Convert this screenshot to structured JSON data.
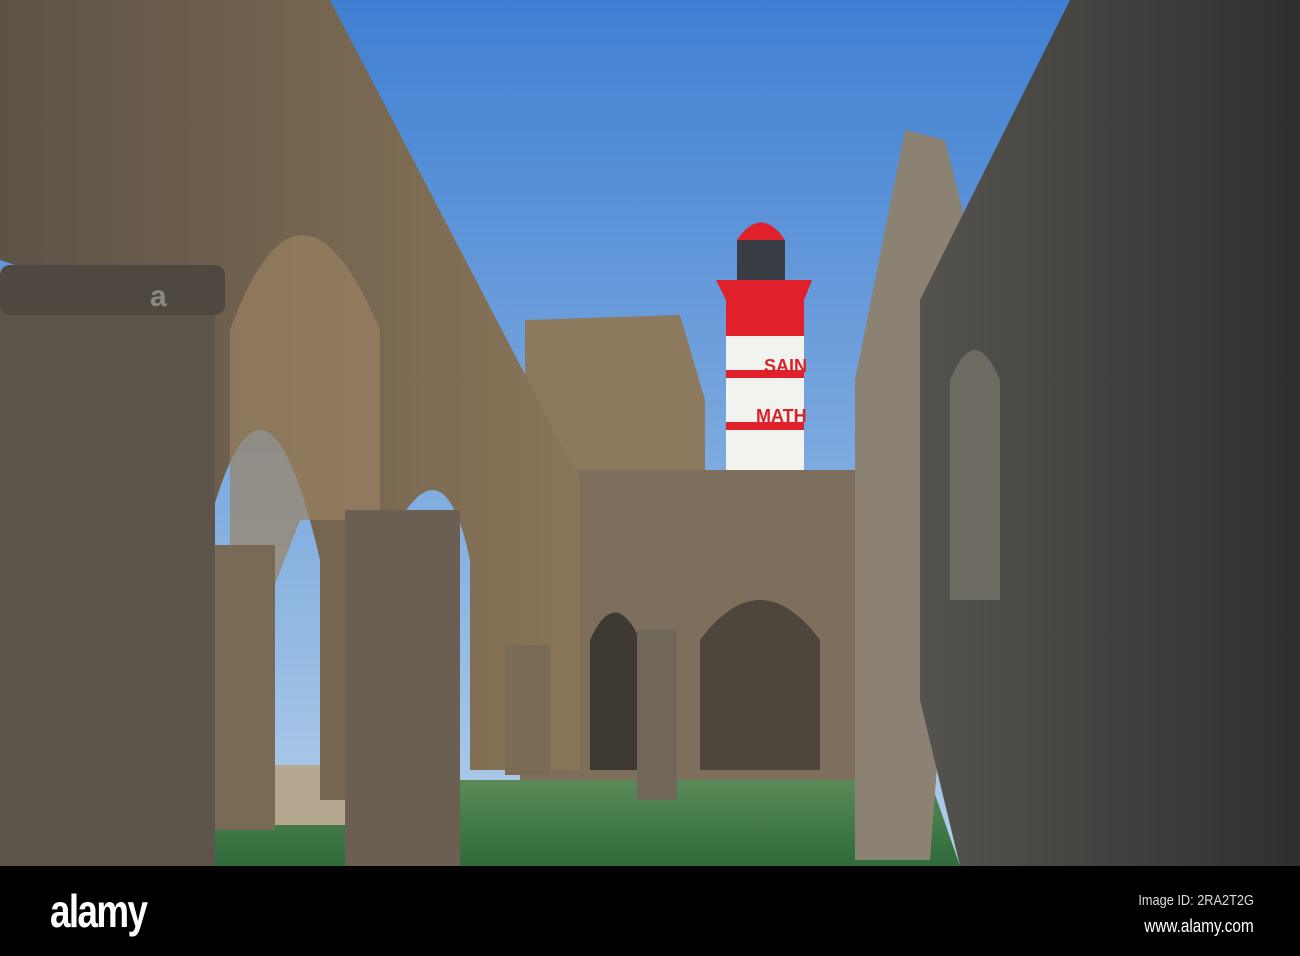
{
  "photo": {
    "lighthouse_text": [
      "SAIN",
      "MATH"
    ],
    "colors": {
      "sky_top": "#4a86d6",
      "sky_bottom": "#a9c9ea",
      "stone": "#7a6a55",
      "stone_dark": "#3f3d3a",
      "grass": "#3f7a44",
      "lighthouse_red": "#e0202a"
    }
  },
  "footer": {
    "logo": "alamy",
    "image_id": "Image ID: 2RA2T2G",
    "website": "www.alamy.com"
  }
}
